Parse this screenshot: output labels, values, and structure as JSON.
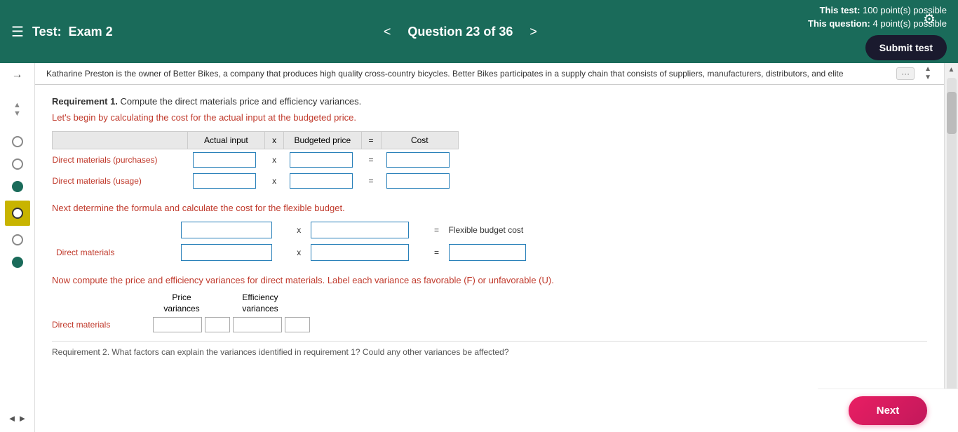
{
  "header": {
    "menu_icon": "☰",
    "test_label": "Test:",
    "exam_name": "Exam 2",
    "nav_prev": "<",
    "nav_next": ">",
    "question_label": "Question 23 of 36",
    "this_test_label": "This test:",
    "this_test_points": "100 point(s) possible",
    "this_question_label": "This question:",
    "this_question_points": "4 point(s) possible",
    "gear_icon": "⚙",
    "submit_btn": "Submit test"
  },
  "sidebar": {
    "arrow_right": "→",
    "scroll_up": "▲",
    "scroll_down": "▼",
    "nav_left": "◄",
    "nav_right": "►"
  },
  "passage": {
    "text": "Katharine Preston is the owner of Better Bikes, a company that produces high quality cross-country bicycles. Better Bikes participates in a supply chain that consists of suppliers, manufacturers, distributors, and elite",
    "expand_icon": "···"
  },
  "content": {
    "requirement1_bold": "Requirement 1.",
    "requirement1_text": " Compute the direct materials price and efficiency variances.",
    "instruction1": "Let's begin by calculating the cost for the actual input at the budgeted price.",
    "table1": {
      "headers": [
        "Actual input",
        "x",
        "Budgeted price",
        "=",
        "Cost"
      ],
      "rows": [
        {
          "label": "Direct materials (purchases)"
        },
        {
          "label": "Direct materials (usage)"
        }
      ]
    },
    "instruction2": "Next determine the formula and calculate the cost for the flexible budget.",
    "table2_rows": [
      {
        "label": ""
      },
      {
        "label": "Direct materials"
      }
    ],
    "flexible_budget_cost": "Flexible budget cost",
    "instruction3": "Now compute the price and efficiency variances for direct materials. Label each variance as favorable (F) or unfavorable (U).",
    "variance_headers": {
      "col1": "Price",
      "col2": "variances",
      "col3": "Efficiency",
      "col4": "variances"
    },
    "variance_row_label": "Direct materials",
    "bottom_text": "Requirement 2. What factors can explain the variances identified in requirement 1? Could any other variances be affected?"
  },
  "footer": {
    "next_btn": "Next"
  }
}
